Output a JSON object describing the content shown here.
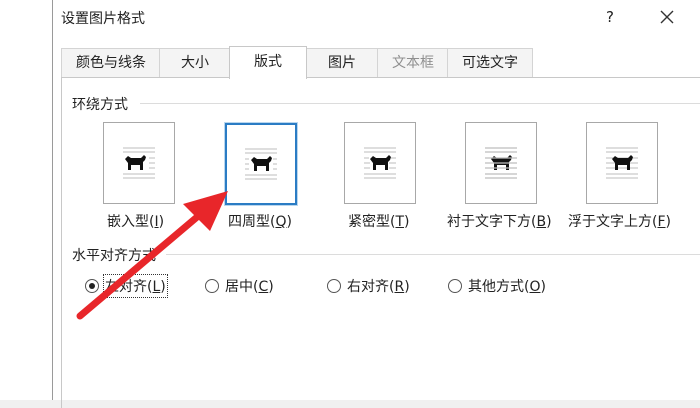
{
  "dialog": {
    "title": "设置图片格式",
    "help_label": "?"
  },
  "tabs": [
    {
      "label": "颜色与线条",
      "active": false,
      "disabled": false
    },
    {
      "label": "大小",
      "active": false,
      "disabled": false
    },
    {
      "label": "版式",
      "active": true,
      "disabled": false
    },
    {
      "label": "图片",
      "active": false,
      "disabled": false
    },
    {
      "label": "文本框",
      "active": false,
      "disabled": true
    },
    {
      "label": "可选文字",
      "active": false,
      "disabled": false
    }
  ],
  "wrap_section": {
    "heading": "环绕方式",
    "options": [
      {
        "label": "嵌入型(",
        "key": "I",
        "suffix": ")",
        "selected": false,
        "icon": "inline-wrap-icon"
      },
      {
        "label": "四周型(",
        "key": "Q",
        "suffix": ")",
        "selected": true,
        "icon": "square-wrap-icon"
      },
      {
        "label": "紧密型(",
        "key": "T",
        "suffix": ")",
        "selected": false,
        "icon": "tight-wrap-icon"
      },
      {
        "label": "衬于文字下方(",
        "key": "B",
        "suffix": ")",
        "selected": false,
        "icon": "behind-text-icon"
      },
      {
        "label": "浮于文字上方(",
        "key": "F",
        "suffix": ")",
        "selected": false,
        "icon": "in-front-of-text-icon"
      }
    ]
  },
  "align_section": {
    "heading": "水平对齐方式",
    "options": [
      {
        "label": "左对齐(",
        "key": "L",
        "suffix": ")",
        "checked": true
      },
      {
        "label": "居中(",
        "key": "C",
        "suffix": ")",
        "checked": false
      },
      {
        "label": "右对齐(",
        "key": "R",
        "suffix": ")",
        "checked": false
      },
      {
        "label": "其他方式(",
        "key": "O",
        "suffix": ")",
        "checked": false
      }
    ]
  },
  "colors": {
    "accent_selection": "#2b7cc4",
    "annotation_arrow": "#e8262a"
  }
}
